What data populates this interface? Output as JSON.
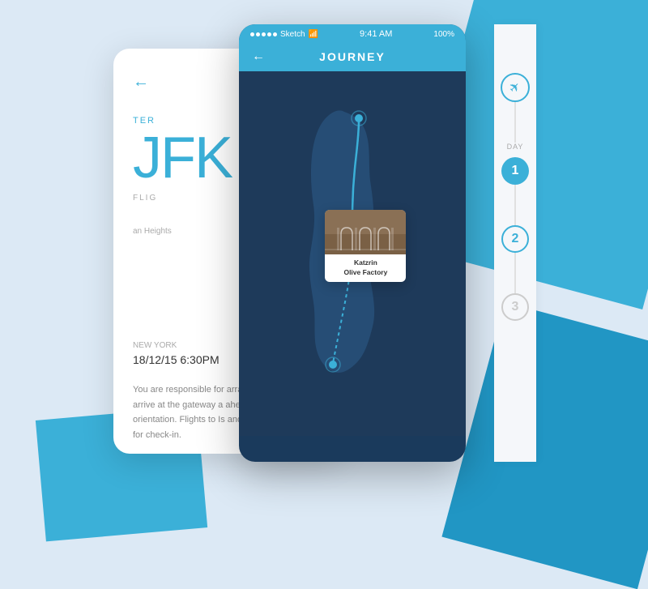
{
  "background": {
    "color": "#dce9f5"
  },
  "status_bar": {
    "signal": "●●●●●",
    "carrier": "Sketch",
    "wifi": "wifi",
    "time": "9:41 AM",
    "battery": "100%"
  },
  "header": {
    "back_arrow": "←",
    "title": "JOURNEY"
  },
  "back_screen": {
    "back_arrow": "←",
    "terminal_label": "TER",
    "airport_code": "JFK",
    "flight_label": "FLIG",
    "location_subtext": "an Heights",
    "city_label": "NEW YORK",
    "date_time": "18/12/15 6:30PM",
    "description": "You are responsible for arrangements to the ga arrive at the gateway a ahead of the outbound orientation. Flights to Is and it is critical that you for check-in."
  },
  "map": {
    "tooltip": {
      "location_line1": "Katzrin",
      "location_line2": "Olive Factory"
    }
  },
  "sidebar": {
    "airplane_icon": "✈",
    "day_label": "DAY",
    "days": [
      {
        "number": "1",
        "state": "active"
      },
      {
        "number": "2",
        "state": "inactive"
      },
      {
        "number": "3",
        "state": "faded"
      }
    ]
  }
}
